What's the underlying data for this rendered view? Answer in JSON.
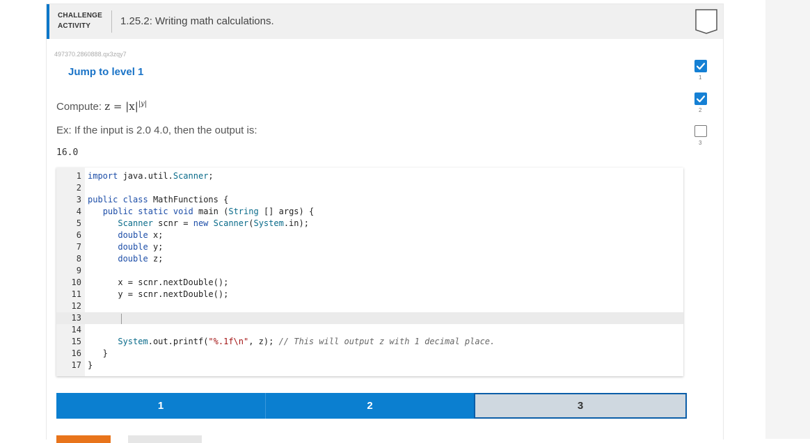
{
  "header": {
    "badge_line1": "CHALLENGE",
    "badge_line2": "ACTIVITY",
    "title": "1.25.2: Writing math calculations."
  },
  "activity_id": "497370.2860888.qx3zqy7",
  "jump_label": "Jump to level 1",
  "prompt": {
    "compute_label": "Compute:",
    "formula_lhs": "z = |x|",
    "formula_exp": "|y|",
    "example": "Ex: If the input is 2.0 4.0, then the output is:",
    "output": "16.0"
  },
  "code_lines": [
    {
      "n": "1",
      "text": "import java.util.Scanner;"
    },
    {
      "n": "2",
      "text": ""
    },
    {
      "n": "3",
      "text": "public class MathFunctions {"
    },
    {
      "n": "4",
      "text": "   public static void main (String [] args) {"
    },
    {
      "n": "5",
      "text": "      Scanner scnr = new Scanner(System.in);"
    },
    {
      "n": "6",
      "text": "      double x;"
    },
    {
      "n": "7",
      "text": "      double y;"
    },
    {
      "n": "8",
      "text": "      double z;"
    },
    {
      "n": "9",
      "text": ""
    },
    {
      "n": "10",
      "text": "      x = scnr.nextDouble();"
    },
    {
      "n": "11",
      "text": "      y = scnr.nextDouble();"
    },
    {
      "n": "12",
      "text": ""
    },
    {
      "n": "13",
      "text": ""
    },
    {
      "n": "14",
      "text": ""
    },
    {
      "n": "15",
      "text": "      System.out.printf(\"%.1f\\n\", z); // This will output z with 1 decimal place."
    },
    {
      "n": "16",
      "text": "   }"
    },
    {
      "n": "17",
      "text": "}"
    }
  ],
  "levels": [
    {
      "label": "1",
      "status": "done"
    },
    {
      "label": "2",
      "status": "done"
    },
    {
      "label": "3",
      "status": "current"
    }
  ],
  "side_progress": [
    {
      "label": "1",
      "status": "done"
    },
    {
      "label": "2",
      "status": "done"
    },
    {
      "label": "3",
      "status": "todo"
    }
  ],
  "colors": {
    "accent": "#0b7fd0",
    "current_level": "#cfd8e0",
    "check_done": "#1580d4",
    "orange_button": "#e8741b"
  },
  "icons": {
    "bookmark": "bookmark-icon",
    "check": "checkmark-icon"
  }
}
